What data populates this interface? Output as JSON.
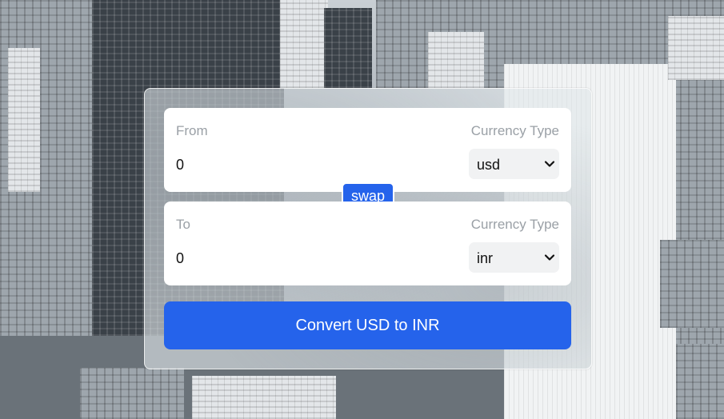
{
  "background": {
    "description_icon": "city-skyline-photo"
  },
  "from": {
    "label": "From",
    "currency_label": "Currency Type",
    "amount": "0",
    "currency": "usd"
  },
  "to": {
    "label": "To",
    "currency_label": "Currency Type",
    "amount": "0",
    "currency": "inr"
  },
  "swap_label": "swap",
  "convert_label": "Convert USD to INR",
  "colors": {
    "accent": "#2563eb",
    "panel": "#ffffff",
    "label": "#9aa0a6"
  }
}
